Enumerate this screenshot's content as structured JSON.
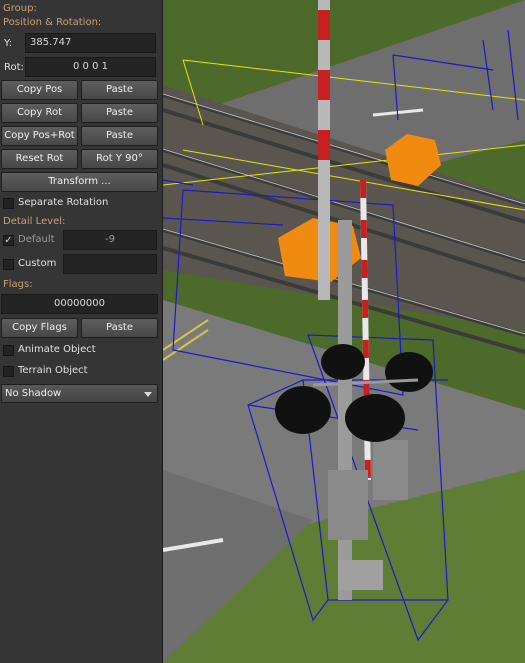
{
  "panel": {
    "group_label": "Group:",
    "position_rotation_label": "Position & Rotation:",
    "y_label": "Y:",
    "y_value": "385.747",
    "rot_label": "Rot:",
    "rot_value": "0 0 0 1",
    "buttons": {
      "copy_pos": "Copy Pos",
      "paste_pos": "Paste",
      "copy_rot": "Copy Rot",
      "paste_rot": "Paste",
      "copy_pos_rot": "Copy Pos+Rot",
      "paste_pos_rot": "Paste",
      "reset_rot": "Reset Rot",
      "rot_y_90": "Rot Y 90°",
      "transform": "Transform ...",
      "copy_flags": "Copy Flags",
      "paste_flags": "Paste"
    },
    "separate_rotation": "Separate Rotation",
    "detail_level_label": "Detail Level:",
    "default_label": "Default",
    "default_value": "-9",
    "custom_label": "Custom",
    "custom_value": "",
    "flags_label": "Flags:",
    "flags_value": "00000000",
    "animate_object": "Animate Object",
    "terrain_object": "Terrain Object",
    "shadow_select": "No Shadow",
    "checkbox_mark": "✓"
  },
  "colors": {
    "panel_bg": "#353535",
    "section_label": "#c7a373",
    "selection_box": "#1a1acc",
    "guide_line": "#e6e600",
    "marker": "#f08a10"
  }
}
